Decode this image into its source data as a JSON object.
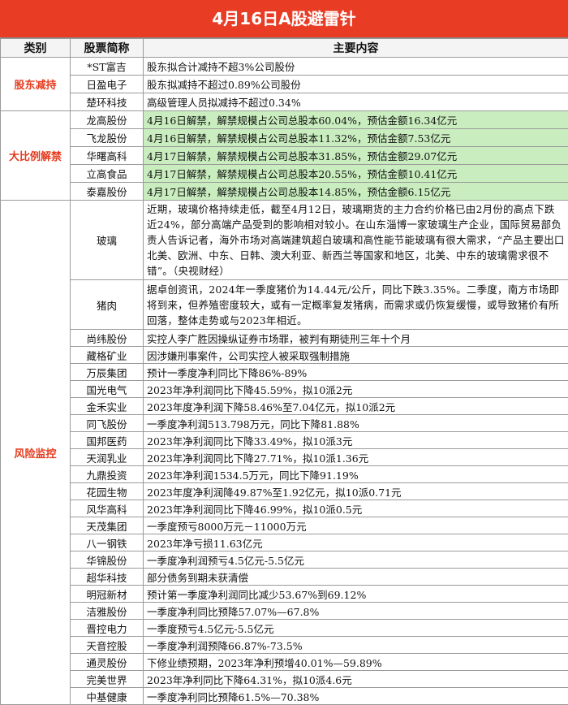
{
  "title": "4月16日A股避雷针",
  "headers": {
    "category": "类别",
    "stock": "股票简称",
    "content": "主要内容"
  },
  "sections": {
    "shareholder_reduce": {
      "label": "股东减持",
      "rows": [
        {
          "name": "*ST富吉",
          "content": "股东拟合计减持不超3%公司股份"
        },
        {
          "name": "日盈电子",
          "content": "股东拟减持不超过0.89%公司股份"
        },
        {
          "name": "楚环科技",
          "content": "高级管理人员拟减持不超过0.34%"
        }
      ]
    },
    "large_unlock": {
      "label": "大比例解禁",
      "rows": [
        {
          "name": "龙高股份",
          "content": "4月16日解禁，解禁规模占公司总股本60.04%，预估金额16.34亿元"
        },
        {
          "name": "飞龙股份",
          "content": "4月16日解禁，解禁规模占公司总股本11.32%，预估金额7.53亿元"
        },
        {
          "name": "华曙高科",
          "content": "4月17日解禁，解禁规模占公司总股本31.85%，预估金额29.07亿元"
        },
        {
          "name": "立高食品",
          "content": "4月17日解禁，解禁规模占公司总股本20.55%，预估金额10.41亿元"
        },
        {
          "name": "泰嘉股份",
          "content": "4月17日解禁，解禁规模占公司总股本14.85%，预估金额6.15亿元"
        }
      ]
    },
    "risk_monitor": {
      "label": "风险监控",
      "industry": [
        {
          "name": "玻璃",
          "content": "近期，玻璃价格持续走低，截至4月12日，玻璃期货的主力合约价格已由2月份的高点下跌近24%，部分高端产品受到的影响相对较小。在山东淄博一家玻璃生产企业，国际贸易部负责人告诉记者，海外市场对高端建筑超白玻璃和高性能节能玻璃有很大需求，“产品主要出口北美、欧洲、中东、日韩、澳大利亚、新西兰等国家和地区，北美、中东的玻璃需求很不错”。（央视财经）"
        },
        {
          "name": "猪肉",
          "content": "据卓创资讯，2024年一季度猪价为14.44元/公斤，同比下跌3.35%。二季度，南方市场即将到来，但养殖密度较大，或有一定概率复发猪病，而需求或仍恢复缓慢，或导致猪价有所回落，整体走势或与2023年相近。"
        }
      ],
      "rows": [
        {
          "name": "尚纬股份",
          "content": "实控人李广胜因操纵证券市场罪，被判有期徒刑三年十个月"
        },
        {
          "name": "藏格矿业",
          "content": "因涉嫌刑事案件，公司实控人被采取强制措施"
        },
        {
          "name": "万辰集团",
          "content": "预计一季度净利同比下降86%-89%"
        },
        {
          "name": "国光电气",
          "content": "2023年净利润同比下降45.59%，拟10派2元"
        },
        {
          "name": "金禾实业",
          "content": "2023年度净利润下降58.46%至7.04亿元，拟10派2元"
        },
        {
          "name": "同飞股份",
          "content": "一季度净利润513.798万元，同比下降81.88%"
        },
        {
          "name": "国邦医药",
          "content": "2023年净利润同比下降33.49%，拟10派3元"
        },
        {
          "name": "天润乳业",
          "content": "2023年净利润同比下降27.71%，拟10派1.36元"
        },
        {
          "name": "九鼎投资",
          "content": "2023年净利润1534.5万元，同比下降91.19%"
        },
        {
          "name": "花园生物",
          "content": "2023年度净利润降49.87%至1.92亿元，拟10派0.71元"
        },
        {
          "name": "风华高科",
          "content": "2023年净利润同比下降46.99%，拟10派0.5元"
        },
        {
          "name": "天茂集团",
          "content": "一季度预亏8000万元－11000万元"
        },
        {
          "name": "八一钢铁",
          "content": "2023年净亏损11.63亿元"
        },
        {
          "name": "华锦股份",
          "content": "一季度净利润预亏4.5亿元-5.5亿元"
        },
        {
          "name": "超华科技",
          "content": "部分债务到期未获清偿"
        },
        {
          "name": "明冠新材",
          "content": "预计第一季度净利润同比减少53.67%到69.12%"
        },
        {
          "name": "洁雅股份",
          "content": "一季度净利同比预降57.07%—67.8%"
        },
        {
          "name": "晋控电力",
          "content": "一季度预亏4.5亿元-5.5亿元"
        },
        {
          "name": "天音控股",
          "content": "一季度净利润预降66.87%-73.5%"
        },
        {
          "name": "通灵股份",
          "content": "下修业绩预期，2023年净利预增40.01%—59.89%"
        },
        {
          "name": "完美世界",
          "content": "2023年净利同比下降64.31%，拟10派4.6元"
        },
        {
          "name": "中基健康",
          "content": "一季度净利同比预降61.5%—70.38%"
        }
      ]
    }
  },
  "colors": {
    "title_bg": "#e83c25",
    "category_text": "#e53a1c",
    "unlock_bg": "#c9edbf"
  }
}
